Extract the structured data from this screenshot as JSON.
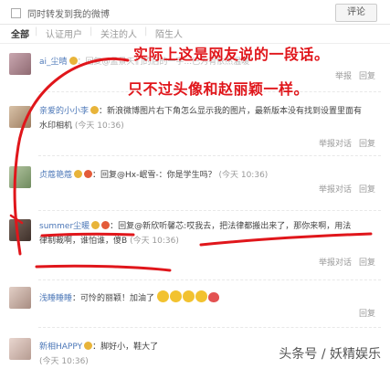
{
  "compose": {
    "forward_label": "同时转发到我的微博",
    "submit_label": "评论"
  },
  "tabs": [
    "全部",
    "认证用户",
    "关注的人",
    "陌生人"
  ],
  "comments": [
    {
      "user": "ai_尘晴",
      "text": "：回复@孟景天们的后的一字...已为有依然温暖",
      "time": "",
      "actions": [
        "举报",
        "回复"
      ]
    },
    {
      "user": "亲爱的小小李",
      "text": "：新浪微博图片右下角怎么显示我的图片，最新版本没有找到设置里面有",
      "text2": "水印相机",
      "time": "(今天 10:36)",
      "actions": [
        "举报对话",
        "回复"
      ]
    },
    {
      "user": "贞蔻艳蔻",
      "text": "：回复@Hx-岷雪-：你是学生吗？",
      "time": "(今天 10:36)",
      "actions": [
        "举报对话",
        "回复"
      ]
    },
    {
      "user": "summer尘暖",
      "text": "：回复@新欣听馨芯:哎我去，把法律都搬出来了，那你来啊，用法",
      "text2": "律制裁啊，谁怕谁，傻B",
      "time": "(今天 10:36)",
      "actions": [
        "举报对话",
        "回复"
      ]
    },
    {
      "user": "浅睡睡睡",
      "text": "：可怜的丽颖！加油了",
      "time": "",
      "actions": [
        "回复"
      ]
    },
    {
      "user": "新相HAPPY",
      "text": "：脚好小，鞋大了",
      "time": "(今天 10:36)",
      "actions": []
    }
  ],
  "annotation": {
    "line1": "实际上这是网友说的一段话。",
    "line2": "只不过头像和赵丽颖一样。"
  },
  "watermark": "头条号 / 妖精娱乐",
  "colors": {
    "annotation": "#e0161b",
    "username": "#4d78b8"
  }
}
